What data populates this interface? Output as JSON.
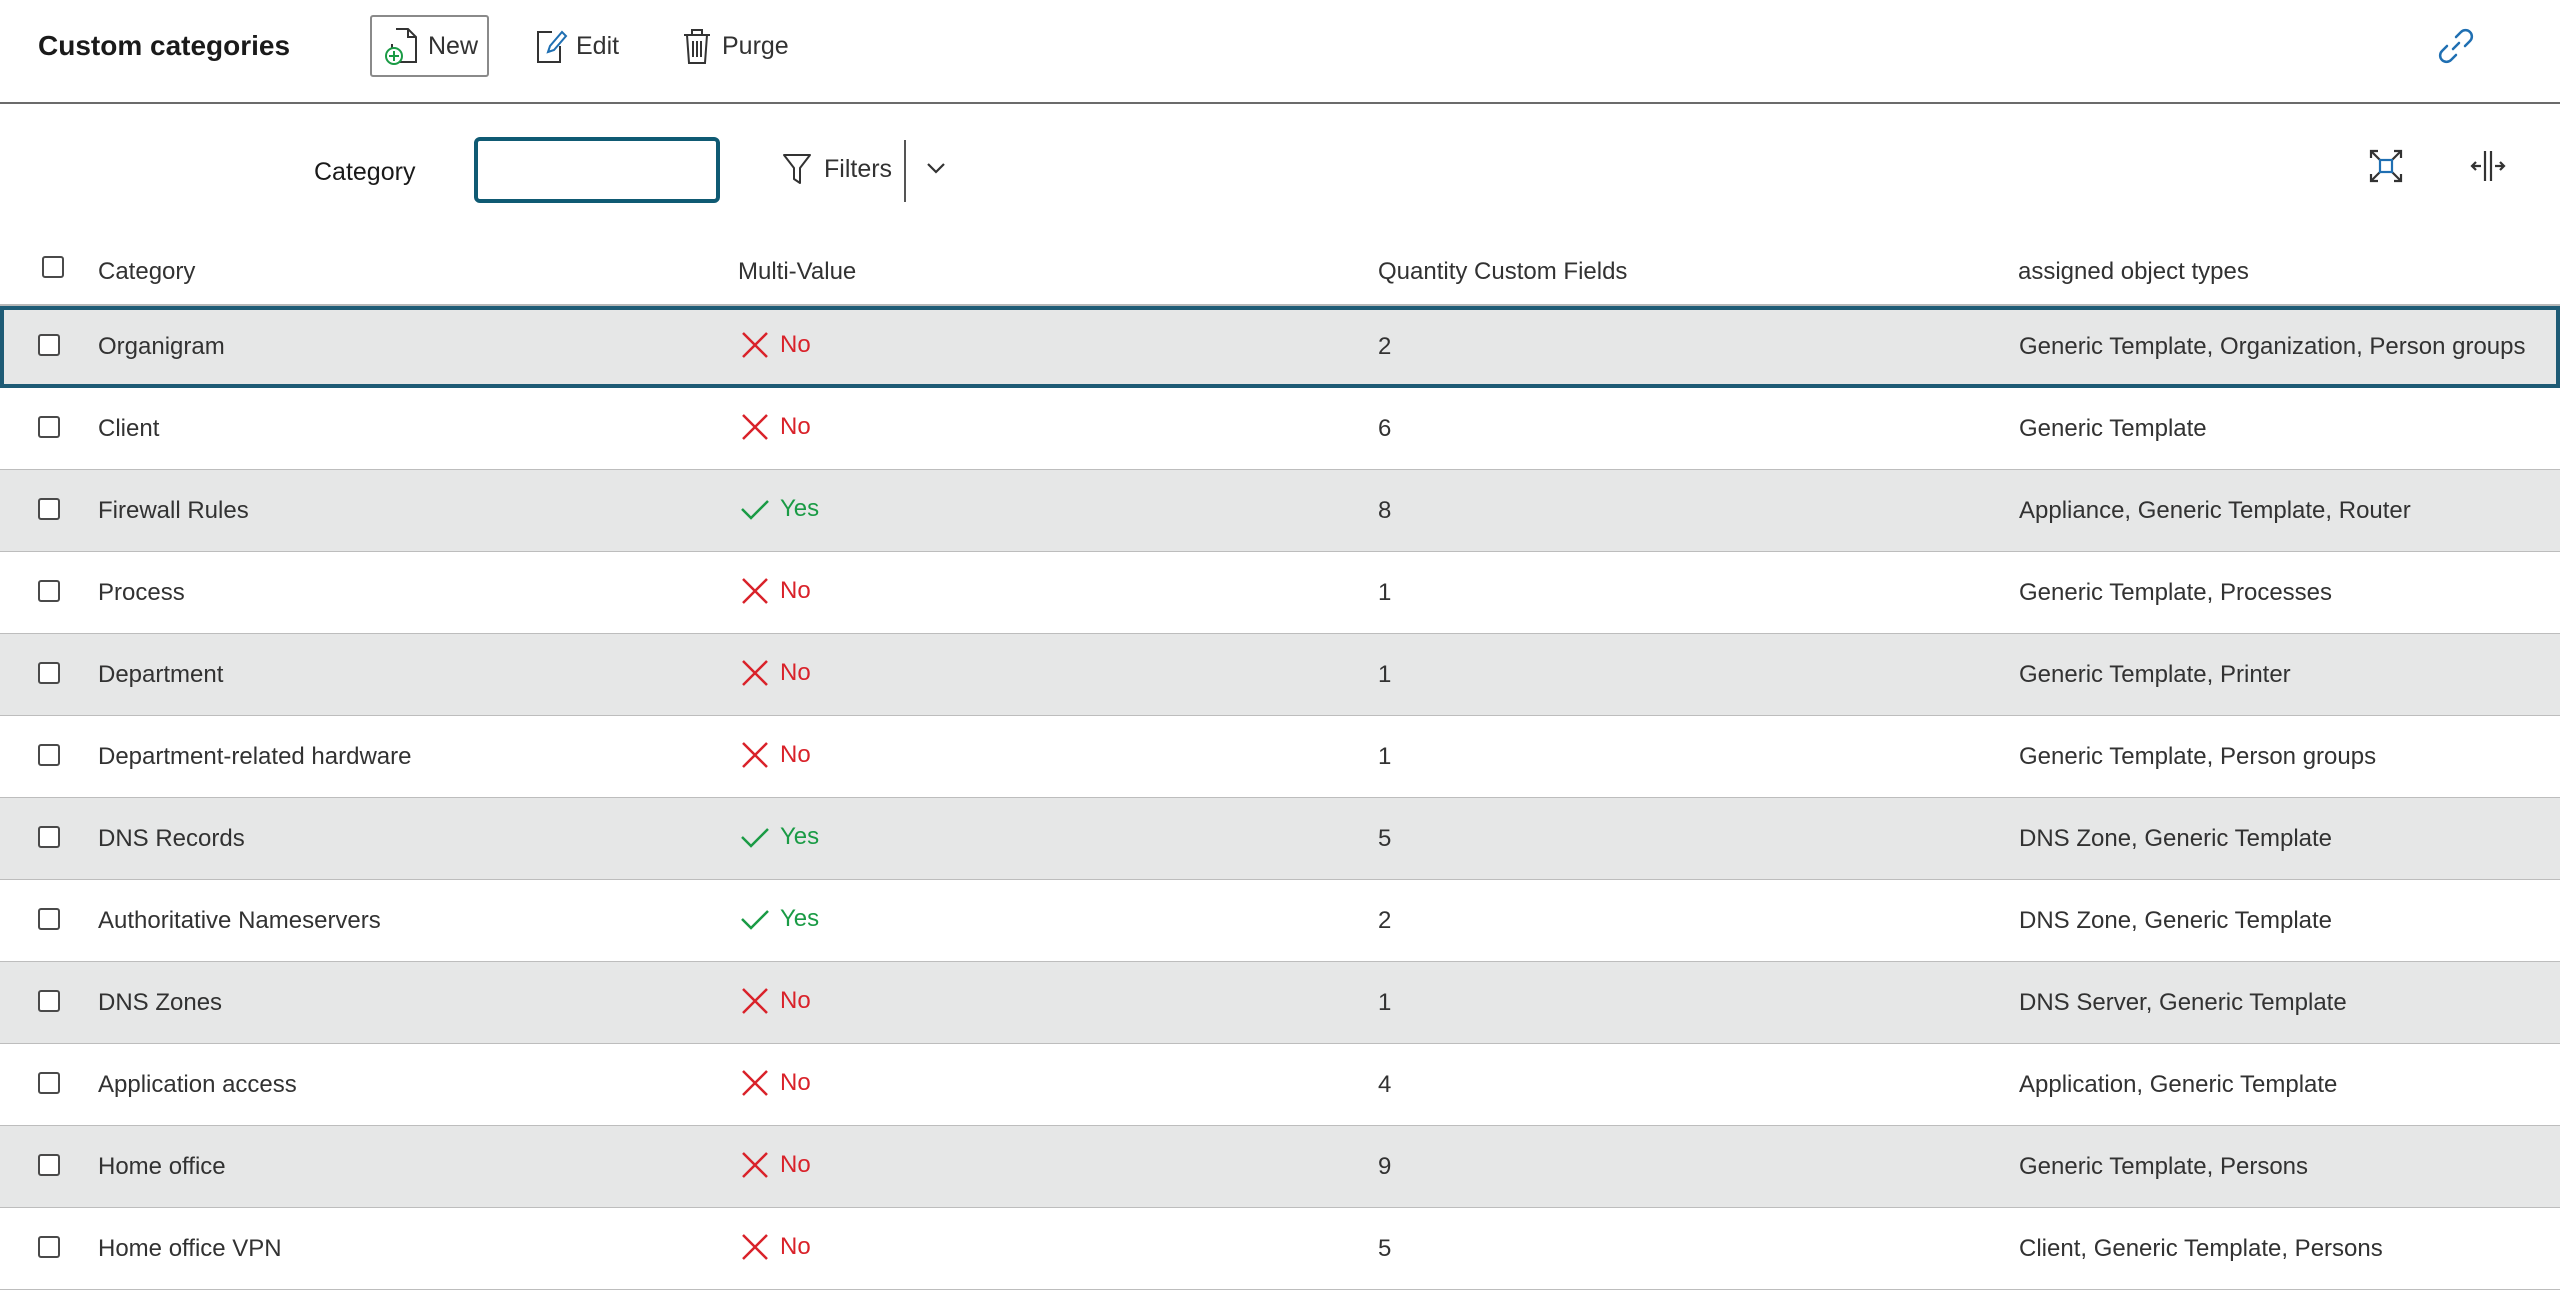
{
  "toolbar": {
    "title": "Custom categories",
    "new_label": "New",
    "edit_label": "Edit",
    "purge_label": "Purge"
  },
  "filter": {
    "label": "Category",
    "value": "",
    "filters_label": "Filters"
  },
  "table": {
    "headers": {
      "category": "Category",
      "multi_value": "Multi-Value",
      "quantity": "Quantity Custom Fields",
      "types": "assigned object types"
    },
    "rows": [
      {
        "category": "Organigram",
        "multi_value": "No",
        "quantity": "2",
        "types": "Generic Template, Organization, Person groups"
      },
      {
        "category": "Client",
        "multi_value": "No",
        "quantity": "6",
        "types": "Generic Template"
      },
      {
        "category": "Firewall Rules",
        "multi_value": "Yes",
        "quantity": "8",
        "types": "Appliance, Generic Template, Router"
      },
      {
        "category": "Process",
        "multi_value": "No",
        "quantity": "1",
        "types": "Generic Template, Processes"
      },
      {
        "category": "Department",
        "multi_value": "No",
        "quantity": "1",
        "types": "Generic Template, Printer"
      },
      {
        "category": "Department-related hardware",
        "multi_value": "No",
        "quantity": "1",
        "types": "Generic Template, Person groups"
      },
      {
        "category": "DNS Records",
        "multi_value": "Yes",
        "quantity": "5",
        "types": "DNS Zone, Generic Template"
      },
      {
        "category": "Authoritative Nameservers",
        "multi_value": "Yes",
        "quantity": "2",
        "types": "DNS Zone, Generic Template"
      },
      {
        "category": "DNS Zones",
        "multi_value": "No",
        "quantity": "1",
        "types": "DNS Server, Generic Template"
      },
      {
        "category": "Application access",
        "multi_value": "No",
        "quantity": "4",
        "types": "Application, Generic Template"
      },
      {
        "category": "Home office",
        "multi_value": "No",
        "quantity": "9",
        "types": "Generic Template, Persons"
      },
      {
        "category": "Home office VPN",
        "multi_value": "No",
        "quantity": "5",
        "types": "Client, Generic Template, Persons"
      }
    ]
  },
  "colors": {
    "accent": "#0f5a73",
    "no": "#d9222a",
    "yes": "#1a9b45",
    "row_alt": "#e6e7e7",
    "new_icon": "#1a9b45",
    "link_icon": "#1f6fb2"
  },
  "icons": [
    "add-document-icon",
    "edit-icon",
    "trash-icon",
    "link-icon",
    "filter-icon",
    "chevron-down-icon",
    "fullscreen-icon",
    "column-resize-icon",
    "cross-icon",
    "check-icon"
  ]
}
